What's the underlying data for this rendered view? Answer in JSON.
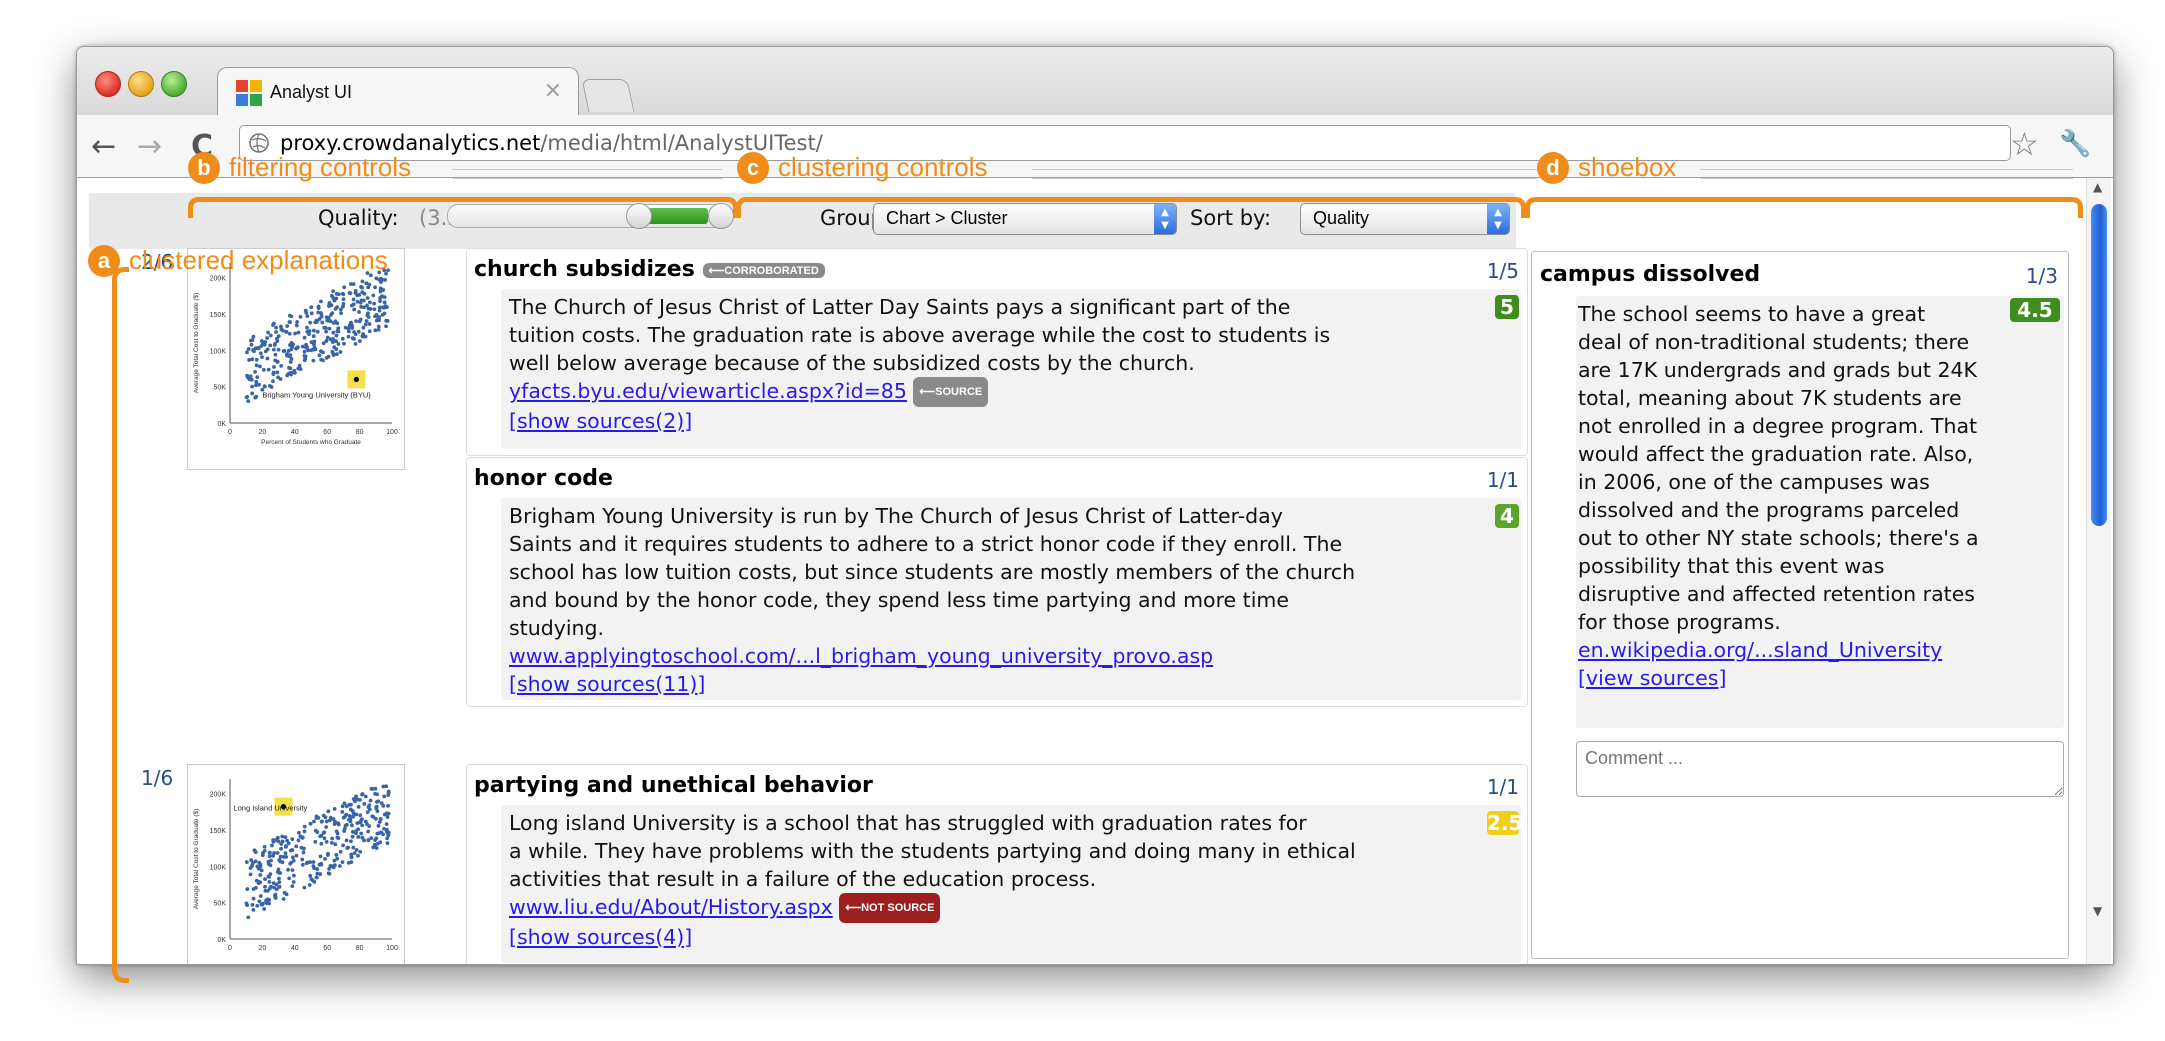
{
  "browser": {
    "tab_title": "Analyst UI",
    "tab_close": "×",
    "url_host": "proxy.crowdanalytics.net",
    "url_path": "/media/html/AnalystUITest/",
    "back": "←",
    "forward": "→",
    "reload": "C"
  },
  "annotations": {
    "a": {
      "letter": "a",
      "label": "clustered explanations"
    },
    "b": {
      "letter": "b",
      "label": "filtering controls"
    },
    "c": {
      "letter": "c",
      "label": "clustering controls"
    },
    "d": {
      "letter": "d",
      "label": "shoebox"
    }
  },
  "controls": {
    "quality_label": "Quality:",
    "quality_range": "(3.5-5)",
    "quality_min": 3.5,
    "quality_max": 5,
    "group_label": "Group by:",
    "group_value": "Chart > Cluster",
    "sort_label": "Sort by:",
    "sort_value": "Quality"
  },
  "chart_data": [
    {
      "type": "scatter",
      "count_label": "2/6",
      "highlight": "Brigham Young University (BYU)",
      "xlabel": "Percent of Students who Graduate",
      "ylabel": "Average Total Cost to Graduate ($)",
      "xticks": [
        "0",
        "20",
        "40",
        "60",
        "80",
        "100"
      ],
      "yticks": [
        "0K",
        "50K",
        "100K",
        "150K",
        "200K"
      ],
      "xlim": [
        0,
        100
      ],
      "ylim": [
        0,
        220000
      ],
      "highlight_point": [
        78,
        60000
      ],
      "point_color": "#3a64a8",
      "highlight_color": "#f4e04a"
    },
    {
      "type": "scatter",
      "count_label": "1/6",
      "highlight": "Long Island University",
      "xlabel": "",
      "ylabel": "Average Total Cost to Graduate ($)",
      "xticks": [
        "0",
        "20",
        "40",
        "60",
        "80",
        "100"
      ],
      "yticks": [
        "0K",
        "50K",
        "100K",
        "150K",
        "200K"
      ],
      "xlim": [
        0,
        100
      ],
      "ylim": [
        0,
        220000
      ],
      "highlight_point": [
        33,
        182000
      ],
      "point_color": "#3a64a8",
      "highlight_color": "#f4e04a"
    }
  ],
  "explanations": [
    {
      "title": "church subsidizes",
      "tag": "⟵CORROBORATED",
      "count": "1/5",
      "score": "5",
      "score_color": "#3e8e1f",
      "text": [
        "The Church of Jesus Christ of Latter Day Saints pays a significant part of the",
        "tuition costs. The graduation rate is above average while the cost to students is",
        "well below average because of the subsidized costs by the church."
      ],
      "link": "yfacts.byu.edu/viewarticle.aspx?id=85",
      "link_tag": "⟵SOURCE",
      "sources": "[show sources(2)]"
    },
    {
      "title": "honor code",
      "count": "1/1",
      "score": "4",
      "score_color": "#5aa62c",
      "text": [
        "Brigham Young University is run by The Church of Jesus Christ of Latter-day",
        "Saints and it requires students to adhere to a strict honor code if they enroll. The",
        "school has low tuition costs, but since students are mostly members of the church",
        "and bound by the honor code, they spend less time partying and more time",
        "studying."
      ],
      "link": "www.applyingtoschool.com/...l_brigham_young_university_provo.asp",
      "sources": "[show sources(11)]"
    },
    {
      "title": "partying and unethical behavior",
      "count": "1/1",
      "score": "2.5",
      "score_color": "#f0cf1c",
      "text": [
        "Long island University is a school that has struggled with graduation rates for",
        "a while. They have problems with the students partying and doing many in ethical",
        "activities that result in a failure of the education process."
      ],
      "link": "www.liu.edu/About/History.aspx",
      "link_tag": "⟵NOT SOURCE",
      "sources": "[show sources(4)]"
    }
  ],
  "shoebox": {
    "title": "campus dissolved",
    "count": "1/3",
    "score": "4.5",
    "score_color": "#3e8e1f",
    "text": [
      "The school seems to have a great",
      "deal of non-traditional students; there",
      "are 17K undergrads and grads but 24K",
      "total, meaning about 7K students are",
      "not enrolled in a degree program. That",
      "would affect the graduation rate. Also,",
      "in 2006, one of the campuses was",
      "dissolved and the programs parceled",
      "out to other NY state schools; there's a",
      "possibility that this event was",
      "disruptive and affected retention rates",
      "for those programs."
    ],
    "link": "en.wikipedia.org/...sland_University",
    "sources": "[view sources]",
    "comment_placeholder": "Comment ..."
  }
}
